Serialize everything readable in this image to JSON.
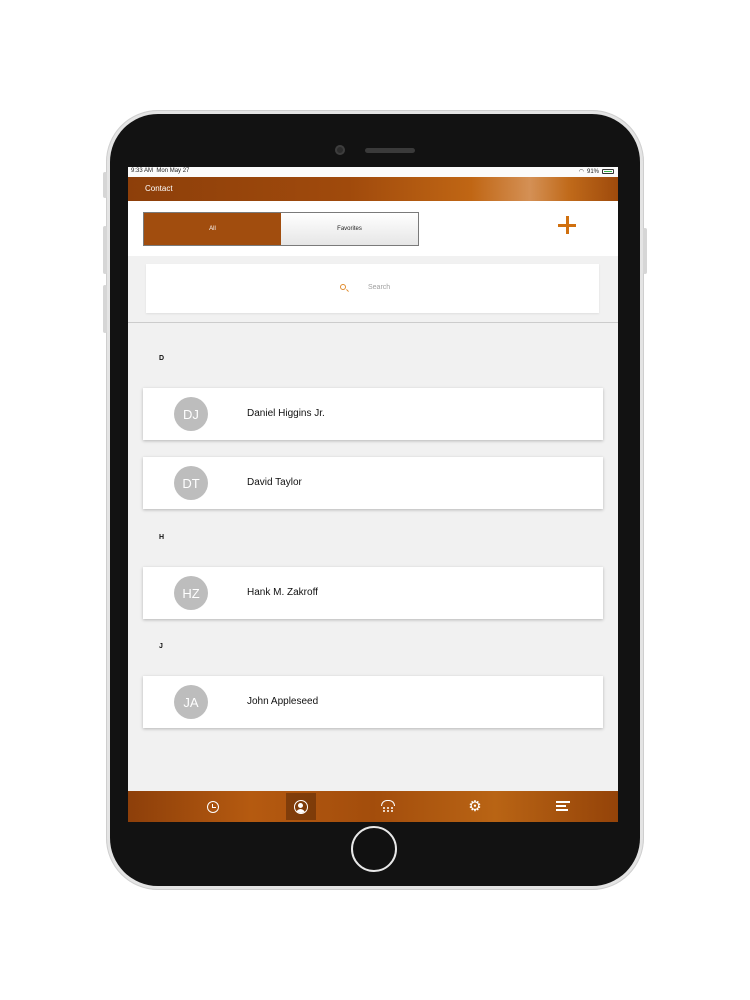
{
  "status_bar": {
    "time": "9:33 AM",
    "date": "Mon May 27",
    "battery": "91%"
  },
  "header": {
    "title": "Contact"
  },
  "segments": {
    "all_label": "All",
    "favorites_label": "Favorites"
  },
  "search": {
    "placeholder": "Search"
  },
  "sections": [
    {
      "letter": "D",
      "contacts": [
        {
          "initials": "DJ",
          "name": "Daniel Higgins Jr."
        },
        {
          "initials": "DT",
          "name": "David Taylor"
        }
      ]
    },
    {
      "letter": "H",
      "contacts": [
        {
          "initials": "HZ",
          "name": "Hank M. Zakroff"
        }
      ]
    },
    {
      "letter": "J",
      "contacts": [
        {
          "initials": "JA",
          "name": "John Appleseed"
        }
      ]
    }
  ],
  "tabs": [
    "history-icon",
    "contacts-icon",
    "dialpad-icon",
    "settings-icon",
    "menu-icon"
  ],
  "colors": {
    "accent": "#a14d0e",
    "add": "#d0700f",
    "avatar": "#bdbdbd"
  }
}
